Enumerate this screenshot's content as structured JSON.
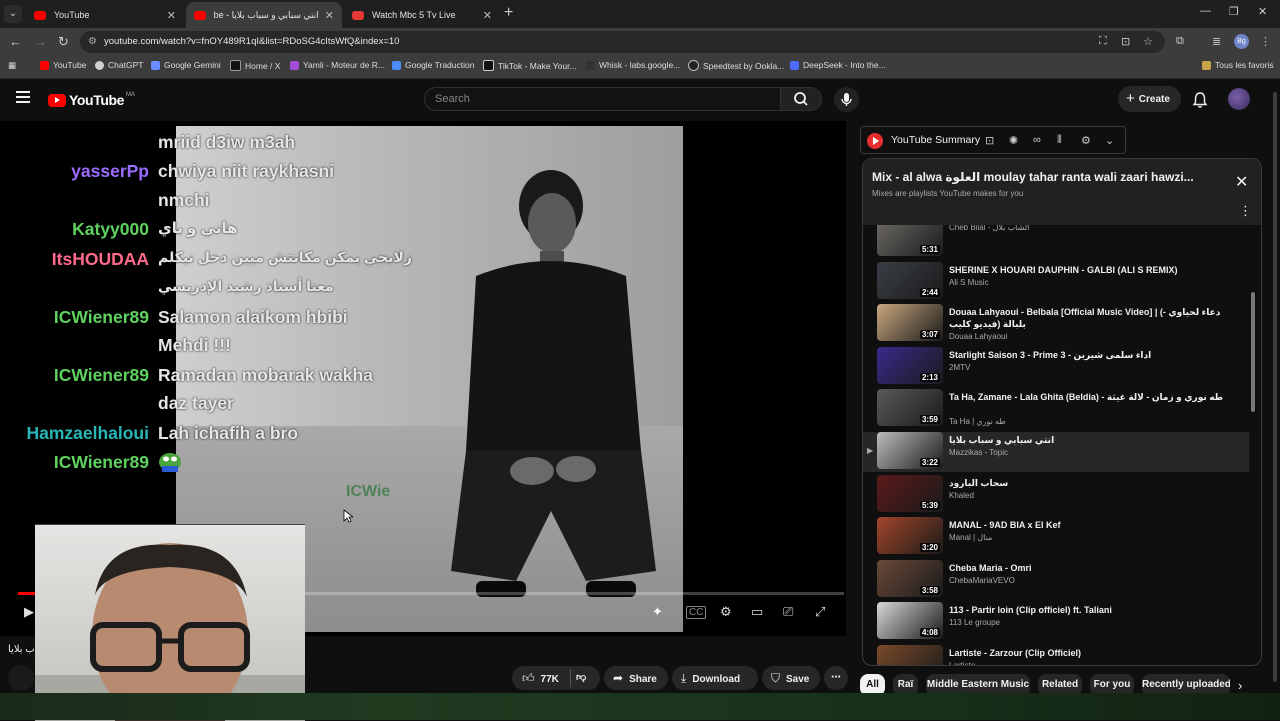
{
  "browser": {
    "tabs": [
      {
        "title": "YouTube",
        "fav_color": "#ff0000"
      },
      {
        "title": "انتي سبابي و سباب بلايا - YouTube",
        "fav_color": "#ff0000"
      },
      {
        "title": "Watch Mbc 5 Tv Live",
        "fav_color": "#e53935"
      }
    ],
    "url": "youtube.com/watch?v=fnOY489R1qI&list=RDoSG4cItsWfQ&index=10",
    "bookmarks": [
      "YouTube",
      "ChatGPT",
      "Google Gemini",
      "Home / X",
      "Yamli - Moteur de R...",
      "Google Traduction",
      "TikTok - Make Your...",
      "Whisk - labs.google...",
      "Speedtest by Ookla...",
      "DeepSeek - Into the..."
    ],
    "all_bookmarks": "Tous les favoris",
    "profile_initials": "Bg"
  },
  "header": {
    "logo": "YouTube",
    "country": "MA",
    "search_placeholder": "Search",
    "create_label": "Create"
  },
  "chat": [
    {
      "user": "",
      "msg": "mriid d3iw m3ah",
      "color": "#e6e6e6"
    },
    {
      "user": "yasserPp",
      "msg": "chwiya niit raykhasni",
      "color": "#9b6cff"
    },
    {
      "user": "",
      "msg": "nmchi",
      "color": "#e6e6e6"
    },
    {
      "user": "Katyy000",
      "msg": "هاني و باي",
      "color": "#5ed15e"
    },
    {
      "user": "ItsHOUDAA",
      "msg": "زلايجي يمكن مكانتش ميين دخل تيكلم",
      "color": "#ff6a8a"
    },
    {
      "user": "",
      "msg": "معنا أستاذ رشيد الإدريسي",
      "color": "#e6e6e6"
    },
    {
      "user": "ICWiener89",
      "msg": "Salamon alaikom hbibi",
      "color": "#5ed15e"
    },
    {
      "user": "",
      "msg": "Mehdi !!!",
      "color": "#e6e6e6"
    },
    {
      "user": "ICWiener89",
      "msg": "Ramadan mobarak wakha",
      "color": "#5ed15e"
    },
    {
      "user": "",
      "msg": "daz tayer",
      "color": "#e6e6e6"
    },
    {
      "user": "Hamzaelhaloui",
      "msg": "Lah ichafih a bro",
      "color": "#28b6b6"
    },
    {
      "user": "ICWiener89",
      "msg": "",
      "color": "#5ed15e"
    }
  ],
  "watermark": "ICWie",
  "video": {
    "progress": 0.02,
    "title_fragment": "ب بلايا"
  },
  "actions": {
    "likes": "77K",
    "share": "Share",
    "download": "Download",
    "save": "Save"
  },
  "summary": {
    "label": "YouTube Summary"
  },
  "playlist": {
    "title": "Mix - al alwa العلوة moulay tahar ranta wali zaari hawzi...",
    "subtitle": "Mixes are playlists YouTube makes for you",
    "items": [
      {
        "title": "",
        "channel": "Cheb Bilal - الشاب بلال",
        "duration": "5:31",
        "thumb": "#6d6a66"
      },
      {
        "title": "SHERINE X HOUARI DAUPHIN - GALBI (ALI S REMIX)",
        "channel": "Ali S Music",
        "duration": "2:44",
        "thumb": "#3b3f46"
      },
      {
        "title": "Douaa Lahyaoui - Belbala [Official Music Video] | (- دعاء لحياوي بلبالة (فيديو كليب",
        "channel": "Douaa Lahyaoui",
        "duration": "3:07",
        "thumb": "#c9a77e"
      },
      {
        "title": "Starlight Saison 3 - Prime 3 - اداء سلمى شيرين",
        "channel": "2MTV",
        "duration": "2:13",
        "thumb": "#3b2a8c"
      },
      {
        "title": "Ta Ha, Zamane - Lala Ghita (Beldia) - طه نوري و زمان - لالة غيثة",
        "channel": "Ta Ha | طه نوري",
        "duration": "3:59",
        "thumb": "#5a5a5a"
      },
      {
        "title": "انتي سبابي و سباب بلايا",
        "channel": "Mazzikas - Topic",
        "duration": "3:22",
        "thumb": "#bdbdbd",
        "current": true
      },
      {
        "title": "سحاب البارود",
        "channel": "Khaled",
        "duration": "5:39",
        "thumb": "#5a1a1a"
      },
      {
        "title": "MANAL - 9AD BIA x El Kef",
        "channel": "Manal | منال",
        "duration": "3:20",
        "thumb": "#a3462a"
      },
      {
        "title": "Cheba Maria - Omri",
        "channel": "ChebaMariaVEVO",
        "duration": "3:58",
        "thumb": "#6a4a3a"
      },
      {
        "title": "113 - Partir loin (Clip officiel) ft. Taliani",
        "channel": "113 Le groupe",
        "duration": "4:08",
        "thumb": "#d8d8d8"
      },
      {
        "title": "Lartiste - Zarzour (Clip Officiel)",
        "channel": "Lartiste",
        "duration": "",
        "thumb": "#7a4a2a"
      }
    ]
  },
  "chips": [
    "All",
    "Raï",
    "Middle Eastern Music",
    "Related",
    "For you",
    "Recently uploaded"
  ]
}
